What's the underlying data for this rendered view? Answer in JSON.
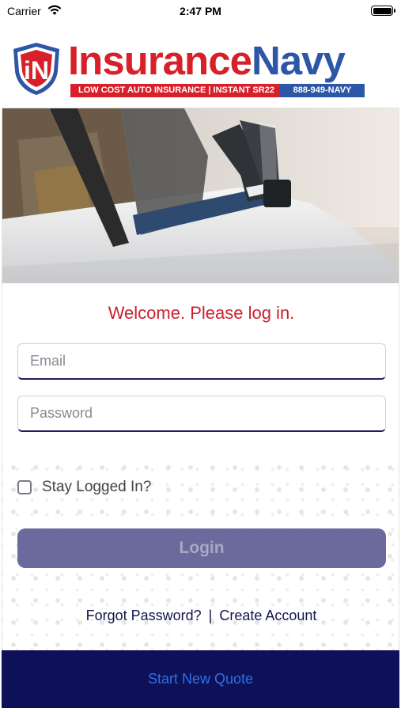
{
  "status_bar": {
    "carrier": "Carrier",
    "time": "2:47 PM"
  },
  "brand": {
    "logo_initials": "iN",
    "name_part1": "Insurance",
    "name_part2": "Navy",
    "tagline_left": "LOW COST AUTO INSURANCE | INSTANT SR22",
    "tagline_right": "888-949-NAVY",
    "colors": {
      "red": "#d7202a",
      "blue": "#2d57a6"
    }
  },
  "hero": {
    "image": "feet-out-car-window-photo"
  },
  "login": {
    "welcome": "Welcome. Please log in.",
    "email_placeholder": "Email",
    "password_placeholder": "Password",
    "remember_label": "Stay Logged In?",
    "remember_checked": false,
    "login_label": "Login",
    "forgot_label": "Forgot Password?",
    "separator": "|",
    "create_label": "Create Account"
  },
  "footer": {
    "start_quote_label": "Start New Quote"
  },
  "colors": {
    "accent": "#cf1f2e",
    "navy": "#0e1158",
    "login_button": "#6a6a9c",
    "link_blue": "#2f6fe8"
  }
}
